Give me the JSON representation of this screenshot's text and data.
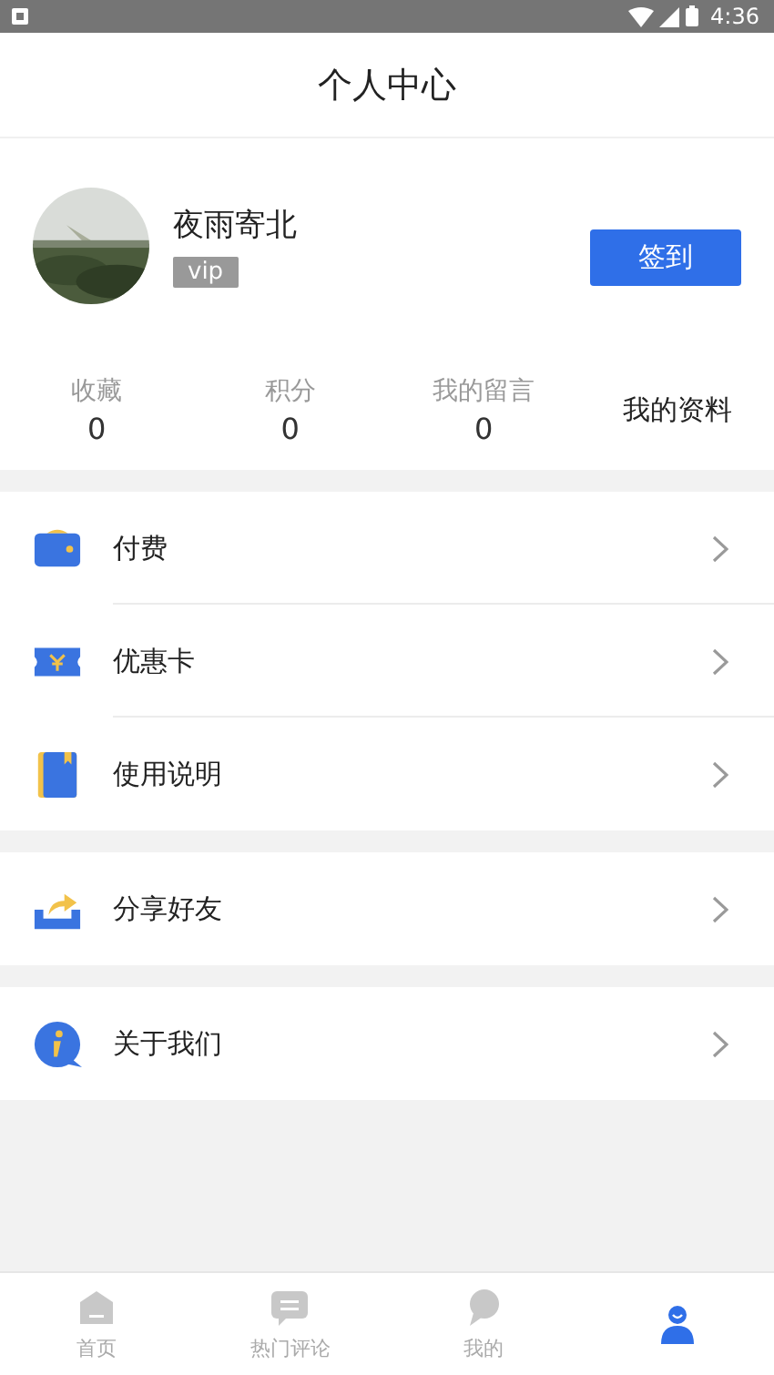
{
  "status_bar": {
    "time": "4:36"
  },
  "header": {
    "title": "个人中心"
  },
  "profile": {
    "name": "夜雨寄北",
    "badge": "vip",
    "sign_in_button": "签到"
  },
  "stats": [
    {
      "label": "收藏",
      "value": "0"
    },
    {
      "label": "积分",
      "value": "0"
    },
    {
      "label": "我的留言",
      "value": "0"
    }
  ],
  "profile_link": "我的资料",
  "menu_groups": [
    [
      {
        "kind": "wallet",
        "label": "付费"
      },
      {
        "kind": "coupon",
        "label": "优惠卡"
      },
      {
        "kind": "manual",
        "label": "使用说明"
      }
    ],
    [
      {
        "kind": "share",
        "label": "分享好友"
      }
    ],
    [
      {
        "kind": "info",
        "label": "关于我们"
      }
    ]
  ],
  "bottom_nav": [
    {
      "kind": "home",
      "label": "首页",
      "selected": false
    },
    {
      "kind": "comments",
      "label": "热门评论",
      "selected": false
    },
    {
      "kind": "messages",
      "label": "我的",
      "selected": false
    },
    {
      "kind": "profile",
      "selected": true
    }
  ]
}
